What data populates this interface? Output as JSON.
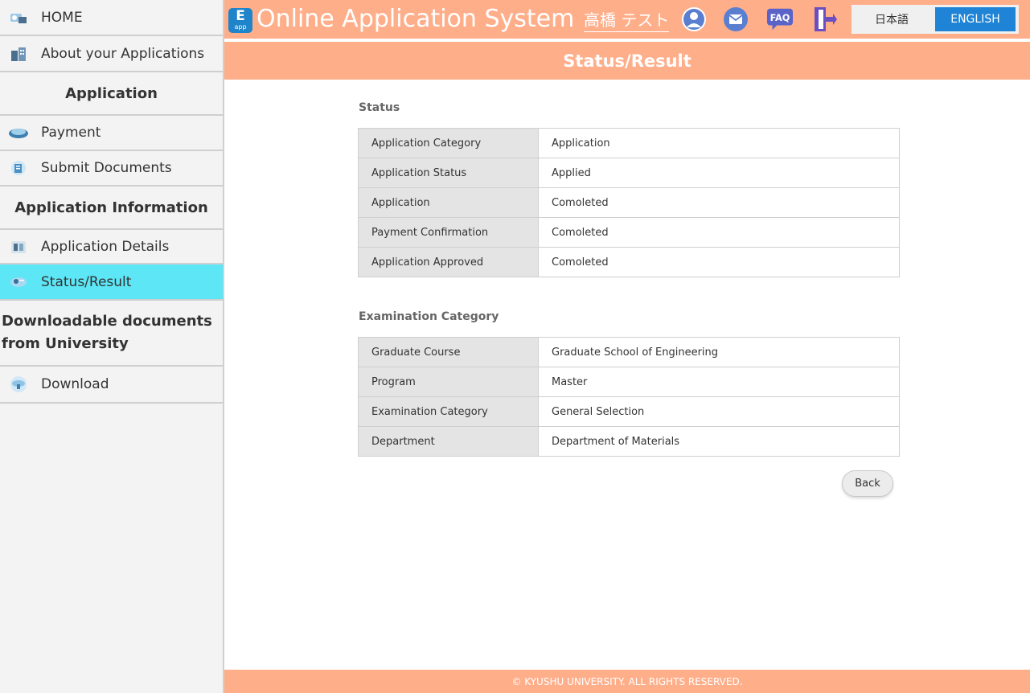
{
  "sidebar": {
    "home": "HOME",
    "about": "About your Applications",
    "heading_application": "Application",
    "payment": "Payment",
    "submit_documents": "Submit Documents",
    "heading_app_info": "Application Information",
    "application_details": "Application Details",
    "status_result": "Status/Result",
    "heading_downloads": "Downloadable documents from University",
    "download": "Download"
  },
  "header": {
    "logo_letter": "E",
    "logo_sub": "app",
    "app_title": "Online Application System",
    "user_name": "高橋 テスト",
    "faq": "FAQ",
    "lang_ja": "日本語",
    "lang_en": "ENGLISH"
  },
  "page_title": "Status/Result",
  "status": {
    "title": "Status",
    "rows": [
      {
        "label": "Application Category",
        "value": "Application"
      },
      {
        "label": "Application Status",
        "value": "Applied"
      },
      {
        "label": "Application",
        "value": "Comoleted"
      },
      {
        "label": "Payment Confirmation",
        "value": "Comoleted"
      },
      {
        "label": "Application Approved",
        "value": "Comoleted"
      }
    ]
  },
  "exam": {
    "title": "Examination Category",
    "rows": [
      {
        "label": "Graduate Course",
        "value": "Graduate School of Engineering"
      },
      {
        "label": "Program",
        "value": "Master"
      },
      {
        "label": "Examination Category",
        "value": "General Selection"
      },
      {
        "label": "Department",
        "value": "Department of Materials"
      }
    ]
  },
  "back_label": "Back",
  "footer": "© KYUSHU UNIVERSITY. ALL RIGHTS RESERVED.",
  "colors": {
    "accent_header": "#ffae8a",
    "active_item": "#5ce6f6",
    "language_selected": "#1f84d6"
  }
}
